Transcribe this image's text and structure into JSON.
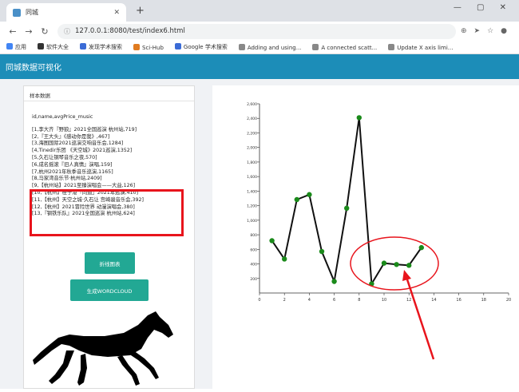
{
  "browser": {
    "tab_title": "同城",
    "url": "127.0.0.1:8080/test/index6.html",
    "bookmarks": [
      "应用",
      "软件大全",
      "发现学术搜索",
      "Sci-Hub",
      "Google 学术搜索",
      "Adding and using...",
      "A connected scatt...",
      "Update X axis limi..."
    ]
  },
  "app": {
    "title": "同城数据可视化"
  },
  "left_card": {
    "title": "样本数据",
    "header_line": "id,name,avgPrice_music",
    "rows": [
      "[1,李大齐『野狼』2021全国巡演 杭州站,719]",
      "[2,『王大头』《感动你是我》,467]",
      "[3,海图国际2021巡演交响音乐会,1284]",
      "[4,Tinedir乐团 《天空城》2021巡演,1352]",
      "[5,久石让钢琴音乐之夜,570]",
      "[6,成名摇滚『旧人真情』演唱,159]",
      "[7,杭州2021年秋季音乐巡演,1165]",
      "[8,马家湾音乐节·杭州站,2409]",
      "[9,【杭州站】2021至臻演唱会——大益,126]",
      "[10,【杭州】桂子港『同道』2021年巡演,410]",
      "[11,【杭州】天空之城·久石让 宫崎骏音乐会,392]",
      "[12,【杭州】2021冒险世界 动漫演唱会,380]",
      "[13,『钢铁乐队』2021全国巡演 杭州站,624]"
    ],
    "btn_chart": "折线图表",
    "btn_wordcloud": "生成WORDCLOUD"
  },
  "chart_data": {
    "type": "line",
    "x": [
      1,
      2,
      3,
      4,
      5,
      6,
      7,
      8,
      9,
      10,
      11,
      12,
      13
    ],
    "y": [
      719,
      467,
      1284,
      1352,
      570,
      159,
      1165,
      2409,
      126,
      410,
      392,
      380,
      624
    ],
    "xlim": [
      0,
      20
    ],
    "ylim": [
      0,
      2600
    ],
    "xticks": [
      "0",
      "2",
      "4",
      "6",
      "8",
      "10",
      "12",
      "14",
      "16",
      "18",
      "20"
    ],
    "yticks": [
      "200",
      "400",
      "600",
      "800",
      "1,000",
      "1,200",
      "1,400",
      "1,600",
      "1,800",
      "2,000",
      "2,200",
      "2,400",
      "2,600"
    ],
    "line_color": "#111111",
    "point_color": "#1a8a1a",
    "grid": false
  },
  "colors": {
    "header": "#1c8db8",
    "button": "#22a894",
    "highlight": "#e8141c"
  }
}
